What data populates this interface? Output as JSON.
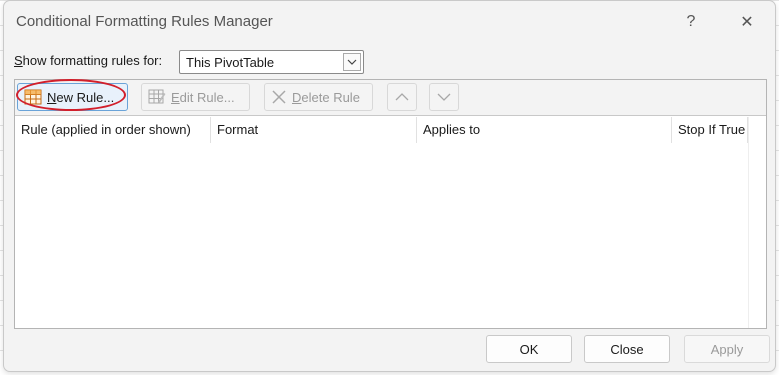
{
  "dialog": {
    "title": "Conditional Formatting Rules Manager",
    "help_glyph": "?",
    "close_glyph": "✕"
  },
  "scope": {
    "label_prefix": "S",
    "label_rest": "how formatting rules for:",
    "selected": "This PivotTable"
  },
  "toolbar": {
    "new_rule_prefix": "N",
    "new_rule_rest": "ew Rule...",
    "edit_rule_prefix": "E",
    "edit_rule_rest": "dit Rule...",
    "delete_rule_prefix": "D",
    "delete_rule_rest": "elete Rule"
  },
  "columns": [
    "Rule (applied in order shown)",
    "Format",
    "Applies to",
    "Stop If True"
  ],
  "footer": {
    "ok": "OK",
    "close": "Close",
    "apply": "Apply"
  },
  "colors": {
    "highlight": "#d21f2b",
    "accent": "#6aa3d8"
  }
}
